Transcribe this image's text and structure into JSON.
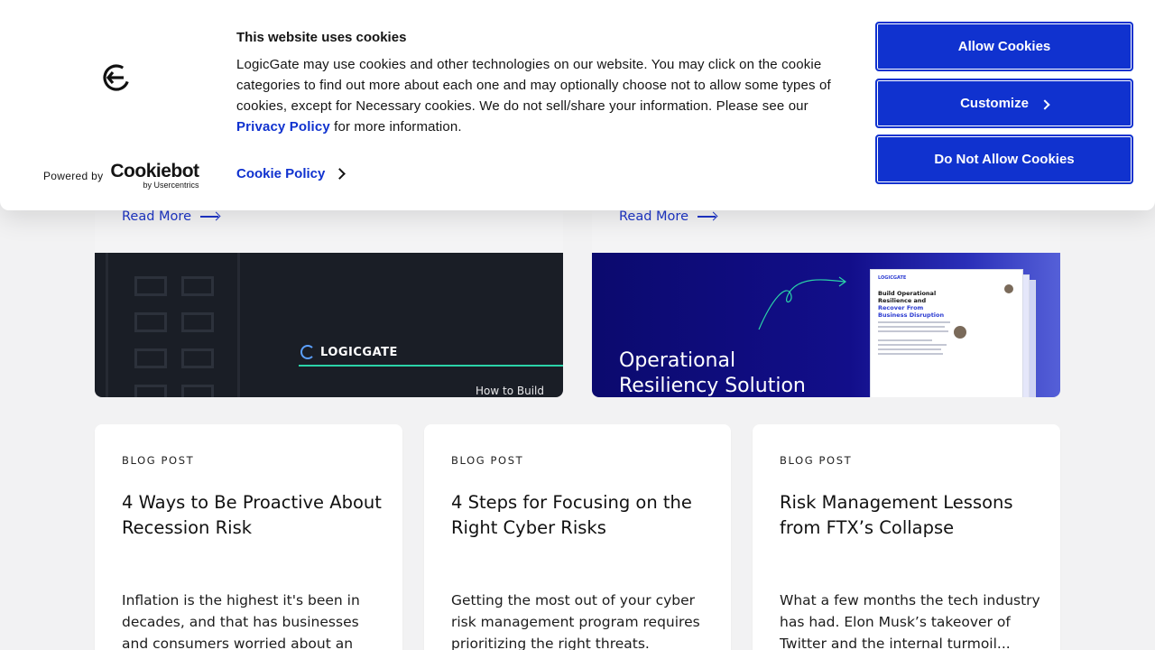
{
  "cookie_banner": {
    "title": "This website uses cookies",
    "body_text": "LogicGate may use cookies and other technologies on our website. You may click on the cookie categories to find out more about each one and may optionally choose not to allow some types of cookies, except for Necessary cookies.  We do not sell/share your information. Please see our ",
    "privacy_link": "Privacy Policy",
    "body_suffix": " for more information.",
    "cookie_policy_link": "Cookie Policy",
    "powered_by": "Powered by",
    "cookiebot_word": "Cookiebot",
    "cookiebot_sub": "by Usercentrics",
    "buttons": {
      "allow": "Allow Cookies",
      "customize": "Customize",
      "deny": "Do Not Allow Cookies"
    },
    "accent_color": "#1032cf"
  },
  "featured_cards": [
    {
      "read_more": "Read More",
      "image": {
        "logo_text": "LOGICGATE",
        "caption": "How to Build"
      }
    },
    {
      "read_more": "Read More",
      "image": {
        "line1": "Operational",
        "line2": "Resiliency Solution",
        "doc_header": "LOGICGATE",
        "doc_title_a": "Build Operational Resilience and ",
        "doc_title_b": "Recover From Business Disruption"
      }
    }
  ],
  "blog_cards": [
    {
      "kicker": "BLOG POST",
      "title": "4 Ways to Be Proactive About Recession Risk",
      "excerpt": "Inflation is the highest it's been in decades, and that has businesses and consumers worried about an"
    },
    {
      "kicker": "BLOG POST",
      "title": "4 Steps for Focusing on the Right Cyber Risks",
      "excerpt": "Getting the most out of your cyber risk management program requires prioritizing the right threats."
    },
    {
      "kicker": "BLOG POST",
      "title": "Risk Management Lessons from FTX’s Collapse",
      "excerpt": "What a few months the tech industry has had.  Elon Musk’s takeover of Twitter and the internal turmoil..."
    }
  ]
}
